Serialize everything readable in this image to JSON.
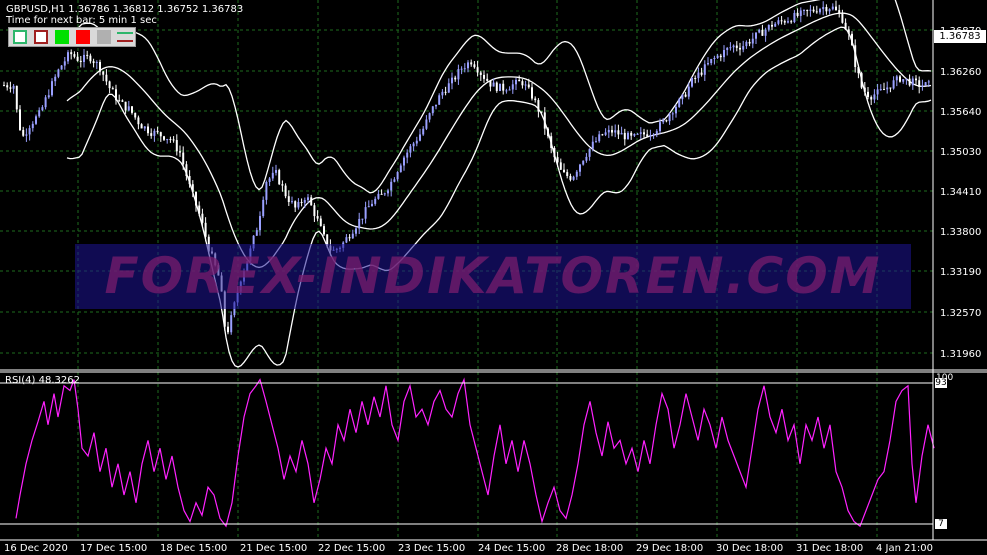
{
  "header": {
    "symbol_line": "GBPUSD,H1  1.36786 1.36812 1.36752 1.36783",
    "timer": "Time for next bar: 5 min 1 sec"
  },
  "toolbar": {
    "buttons": [
      {
        "name": "outline-green",
        "fill": "#ffffff",
        "border": "#2db66b"
      },
      {
        "name": "outline-red",
        "fill": "#ffffff",
        "border": "#a02020"
      },
      {
        "name": "solid-green",
        "fill": "#00e000",
        "border": "#00e000"
      },
      {
        "name": "solid-red",
        "fill": "#ff0000",
        "border": "#ff0000"
      },
      {
        "name": "solid-gray",
        "fill": "#b0b0b0",
        "border": "#b0b0b0"
      },
      {
        "name": "lines-icon",
        "fill": "#d9d9d9",
        "border": "#d9d9d9"
      }
    ]
  },
  "price_axis": {
    "labels": [
      "1.36870",
      "1.36260",
      "1.35640",
      "1.35030",
      "1.34410",
      "1.33800",
      "1.33190",
      "1.32570",
      "1.31960"
    ],
    "current_price": "1.36783"
  },
  "time_axis": {
    "labels": [
      "16 Dec 2020",
      "17 Dec 15:00",
      "18 Dec 15:00",
      "21 Dec 15:00",
      "22 Dec 15:00",
      "23 Dec 15:00",
      "24 Dec 15:00",
      "28 Dec 18:00",
      "29 Dec 18:00",
      "30 Dec 18:00",
      "31 Dec 18:00",
      "4 Jan 21:00"
    ]
  },
  "watermark": {
    "text": "FOREX-INDIKATOREN.COM"
  },
  "rsi_panel": {
    "label": "RSI(4) 48.3262",
    "level_high": "93",
    "level_low": "7",
    "top_value": "100"
  },
  "colors": {
    "background": "#000000",
    "grid": "#1e6b1e",
    "candle_bull": "#9aa0ff",
    "candle_bear": "#ffffff",
    "bands": "#ffffff",
    "rsi": "#ff22ff"
  },
  "chart_data": {
    "type": "candlestick",
    "symbol": "GBPUSD",
    "timeframe": "H1",
    "ylim": [
      1.3175,
      1.3695
    ],
    "close_path": [
      [
        16,
        1.3545
      ],
      [
        22,
        1.35
      ],
      [
        30,
        1.352
      ],
      [
        40,
        1.3535
      ],
      [
        50,
        1.357
      ],
      [
        60,
        1.36
      ],
      [
        70,
        1.362
      ],
      [
        80,
        1.361
      ],
      [
        90,
        1.3615
      ],
      [
        100,
        1.36
      ],
      [
        110,
        1.357
      ],
      [
        120,
        1.355
      ],
      [
        130,
        1.354
      ],
      [
        140,
        1.352
      ],
      [
        150,
        1.351
      ],
      [
        160,
        1.3505
      ],
      [
        170,
        1.35
      ],
      [
        180,
        1.348
      ],
      [
        190,
        1.343
      ],
      [
        200,
        1.339
      ],
      [
        210,
        1.334
      ],
      [
        220,
        1.33
      ],
      [
        226,
        1.322
      ],
      [
        232,
        1.325
      ],
      [
        240,
        1.33
      ],
      [
        250,
        1.334
      ],
      [
        258,
        1.338
      ],
      [
        266,
        1.344
      ],
      [
        276,
        1.345
      ],
      [
        286,
        1.342
      ],
      [
        296,
        1.34
      ],
      [
        306,
        1.342
      ],
      [
        316,
        1.339
      ],
      [
        324,
        1.336
      ],
      [
        332,
        1.334
      ],
      [
        342,
        1.335
      ],
      [
        352,
        1.337
      ],
      [
        362,
        1.339
      ],
      [
        372,
        1.341
      ],
      [
        382,
        1.342
      ],
      [
        392,
        1.344
      ],
      [
        402,
        1.347
      ],
      [
        412,
        1.349
      ],
      [
        422,
        1.351
      ],
      [
        432,
        1.354
      ],
      [
        442,
        1.3565
      ],
      [
        452,
        1.358
      ],
      [
        462,
        1.36
      ],
      [
        472,
        1.361
      ],
      [
        482,
        1.359
      ],
      [
        492,
        1.3575
      ],
      [
        502,
        1.357
      ],
      [
        512,
        1.3575
      ],
      [
        522,
        1.358
      ],
      [
        532,
        1.356
      ],
      [
        542,
        1.353
      ],
      [
        552,
        1.348
      ],
      [
        562,
        1.345
      ],
      [
        572,
        1.3445
      ],
      [
        582,
        1.347
      ],
      [
        592,
        1.349
      ],
      [
        602,
        1.3505
      ],
      [
        612,
        1.351
      ],
      [
        622,
        1.3505
      ],
      [
        632,
        1.35
      ],
      [
        642,
        1.3505
      ],
      [
        652,
        1.351
      ],
      [
        662,
        1.352
      ],
      [
        672,
        1.354
      ],
      [
        682,
        1.3555
      ],
      [
        692,
        1.358
      ],
      [
        702,
        1.3595
      ],
      [
        712,
        1.361
      ],
      [
        722,
        1.362
      ],
      [
        732,
        1.363
      ],
      [
        742,
        1.363
      ],
      [
        752,
        1.364
      ],
      [
        762,
        1.365
      ],
      [
        772,
        1.366
      ],
      [
        782,
        1.3665
      ],
      [
        792,
        1.367
      ],
      [
        802,
        1.3675
      ],
      [
        812,
        1.368
      ],
      [
        822,
        1.3685
      ],
      [
        832,
        1.3685
      ],
      [
        842,
        1.367
      ],
      [
        850,
        1.364
      ],
      [
        856,
        1.36
      ],
      [
        862,
        1.357
      ],
      [
        870,
        1.356
      ],
      [
        880,
        1.3565
      ],
      [
        890,
        1.3575
      ],
      [
        900,
        1.3585
      ],
      [
        910,
        1.358
      ],
      [
        920,
        1.3575
      ],
      [
        930,
        1.3575
      ]
    ],
    "rsi_path": [
      [
        16,
        10
      ],
      [
        20,
        25
      ],
      [
        26,
        45
      ],
      [
        32,
        60
      ],
      [
        38,
        72
      ],
      [
        44,
        85
      ],
      [
        48,
        70
      ],
      [
        54,
        90
      ],
      [
        58,
        75
      ],
      [
        64,
        95
      ],
      [
        70,
        92
      ],
      [
        74,
        99
      ],
      [
        78,
        80
      ],
      [
        82,
        55
      ],
      [
        88,
        50
      ],
      [
        94,
        65
      ],
      [
        100,
        40
      ],
      [
        106,
        55
      ],
      [
        112,
        30
      ],
      [
        118,
        45
      ],
      [
        124,
        25
      ],
      [
        130,
        40
      ],
      [
        136,
        20
      ],
      [
        142,
        45
      ],
      [
        148,
        60
      ],
      [
        154,
        40
      ],
      [
        160,
        55
      ],
      [
        166,
        35
      ],
      [
        172,
        50
      ],
      [
        178,
        30
      ],
      [
        184,
        15
      ],
      [
        190,
        8
      ],
      [
        196,
        20
      ],
      [
        202,
        12
      ],
      [
        208,
        30
      ],
      [
        214,
        25
      ],
      [
        220,
        10
      ],
      [
        226,
        5
      ],
      [
        232,
        20
      ],
      [
        238,
        50
      ],
      [
        244,
        75
      ],
      [
        250,
        90
      ],
      [
        256,
        95
      ],
      [
        260,
        99
      ],
      [
        266,
        85
      ],
      [
        272,
        70
      ],
      [
        278,
        55
      ],
      [
        284,
        35
      ],
      [
        290,
        50
      ],
      [
        296,
        40
      ],
      [
        302,
        60
      ],
      [
        308,
        45
      ],
      [
        314,
        20
      ],
      [
        320,
        35
      ],
      [
        326,
        55
      ],
      [
        332,
        45
      ],
      [
        338,
        70
      ],
      [
        344,
        60
      ],
      [
        350,
        80
      ],
      [
        356,
        65
      ],
      [
        362,
        85
      ],
      [
        368,
        70
      ],
      [
        374,
        88
      ],
      [
        380,
        75
      ],
      [
        386,
        95
      ],
      [
        392,
        70
      ],
      [
        398,
        60
      ],
      [
        404,
        85
      ],
      [
        410,
        95
      ],
      [
        416,
        75
      ],
      [
        422,
        80
      ],
      [
        428,
        70
      ],
      [
        434,
        85
      ],
      [
        440,
        92
      ],
      [
        446,
        80
      ],
      [
        452,
        75
      ],
      [
        458,
        90
      ],
      [
        464,
        99
      ],
      [
        470,
        70
      ],
      [
        476,
        55
      ],
      [
        482,
        40
      ],
      [
        488,
        25
      ],
      [
        494,
        50
      ],
      [
        500,
        70
      ],
      [
        506,
        45
      ],
      [
        512,
        60
      ],
      [
        518,
        40
      ],
      [
        524,
        60
      ],
      [
        530,
        45
      ],
      [
        536,
        25
      ],
      [
        542,
        8
      ],
      [
        548,
        20
      ],
      [
        554,
        30
      ],
      [
        560,
        15
      ],
      [
        566,
        10
      ],
      [
        572,
        25
      ],
      [
        578,
        45
      ],
      [
        584,
        70
      ],
      [
        590,
        85
      ],
      [
        596,
        65
      ],
      [
        602,
        50
      ],
      [
        608,
        72
      ],
      [
        614,
        55
      ],
      [
        620,
        60
      ],
      [
        626,
        45
      ],
      [
        632,
        55
      ],
      [
        638,
        40
      ],
      [
        644,
        60
      ],
      [
        650,
        45
      ],
      [
        656,
        70
      ],
      [
        662,
        90
      ],
      [
        668,
        80
      ],
      [
        674,
        55
      ],
      [
        680,
        70
      ],
      [
        686,
        90
      ],
      [
        692,
        75
      ],
      [
        698,
        60
      ],
      [
        704,
        80
      ],
      [
        710,
        70
      ],
      [
        716,
        55
      ],
      [
        722,
        75
      ],
      [
        728,
        60
      ],
      [
        734,
        50
      ],
      [
        740,
        40
      ],
      [
        746,
        30
      ],
      [
        752,
        55
      ],
      [
        758,
        80
      ],
      [
        764,
        95
      ],
      [
        770,
        75
      ],
      [
        776,
        65
      ],
      [
        782,
        80
      ],
      [
        788,
        60
      ],
      [
        794,
        70
      ],
      [
        800,
        45
      ],
      [
        806,
        70
      ],
      [
        812,
        60
      ],
      [
        818,
        75
      ],
      [
        824,
        55
      ],
      [
        830,
        70
      ],
      [
        836,
        40
      ],
      [
        842,
        30
      ],
      [
        848,
        15
      ],
      [
        854,
        8
      ],
      [
        860,
        5
      ],
      [
        866,
        15
      ],
      [
        872,
        25
      ],
      [
        878,
        35
      ],
      [
        884,
        40
      ],
      [
        890,
        60
      ],
      [
        896,
        85
      ],
      [
        902,
        92
      ],
      [
        908,
        95
      ],
      [
        912,
        45
      ],
      [
        916,
        20
      ],
      [
        922,
        50
      ],
      [
        928,
        70
      ],
      [
        934,
        55
      ]
    ]
  }
}
